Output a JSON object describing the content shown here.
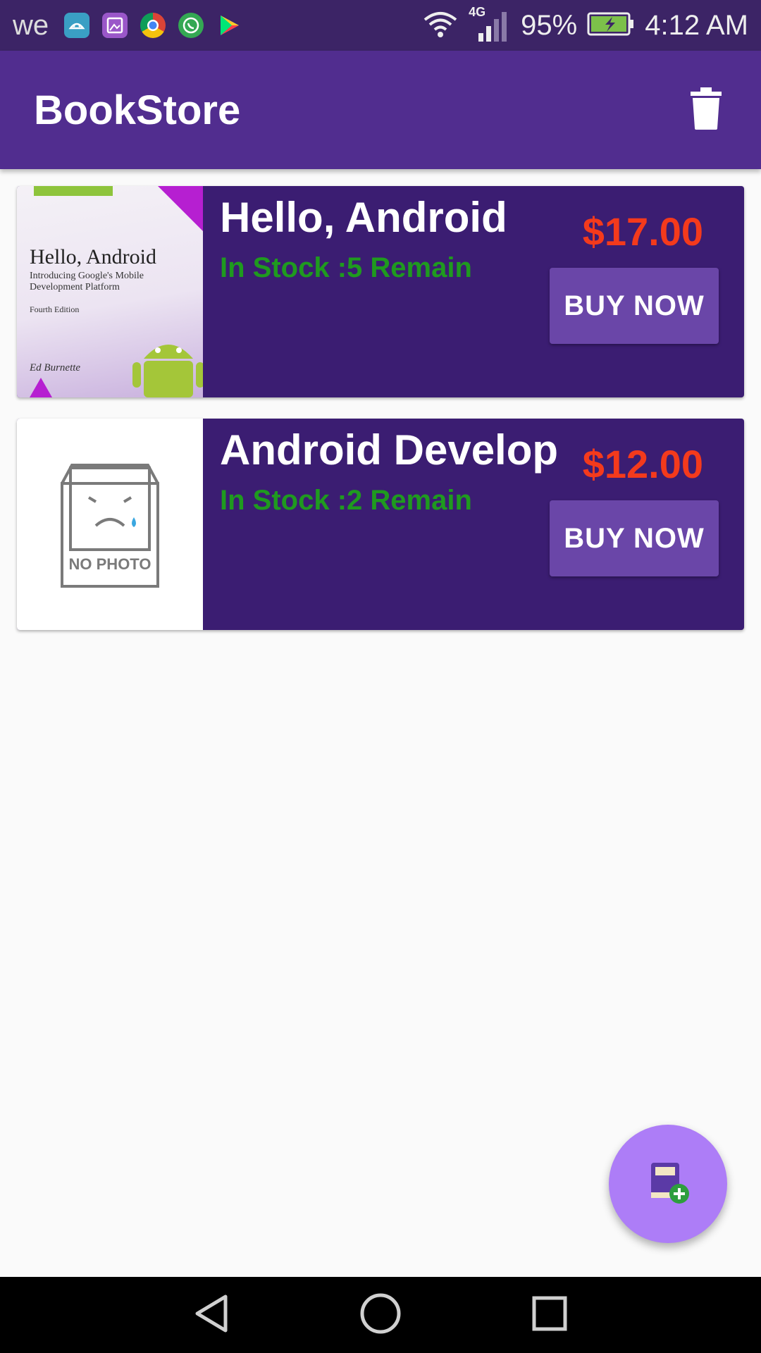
{
  "status_bar": {
    "carrier": "we",
    "network_type": "4G",
    "battery": "95%",
    "time": "4:12 AM",
    "notification_icons": [
      "android-icon",
      "gallery-icon",
      "chrome-icon",
      "whatsapp-icon",
      "play-store-icon"
    ]
  },
  "app_bar": {
    "title": "BookStore",
    "action_icon": "trash-icon"
  },
  "books": [
    {
      "title": "Hello, Android",
      "stock": "In Stock :5 Remain",
      "price": "$17.00",
      "buy_label": "BUY NOW",
      "cover": {
        "title": "Hello, Android",
        "subtitle": "Introducing Google's Mobile Development Platform",
        "edition": "Fourth Edition",
        "author": "Ed Burnette"
      }
    },
    {
      "title": "Android Develop",
      "stock": "In Stock :2 Remain",
      "price": "$12.00",
      "buy_label": "BUY NOW",
      "cover": {
        "placeholder": "NO PHOTO"
      }
    }
  ],
  "fab": {
    "icon": "add-book-icon"
  },
  "nav_bar": {
    "icons": [
      "back-icon",
      "home-icon",
      "recents-icon"
    ]
  },
  "colors": {
    "status_bar": "#3c2466",
    "app_bar": "#512d8f",
    "card": "#3b1d72",
    "price": "#f43a1c",
    "stock": "#1f9a1f",
    "button": "#6a46a8",
    "fab": "#ad7df7"
  }
}
